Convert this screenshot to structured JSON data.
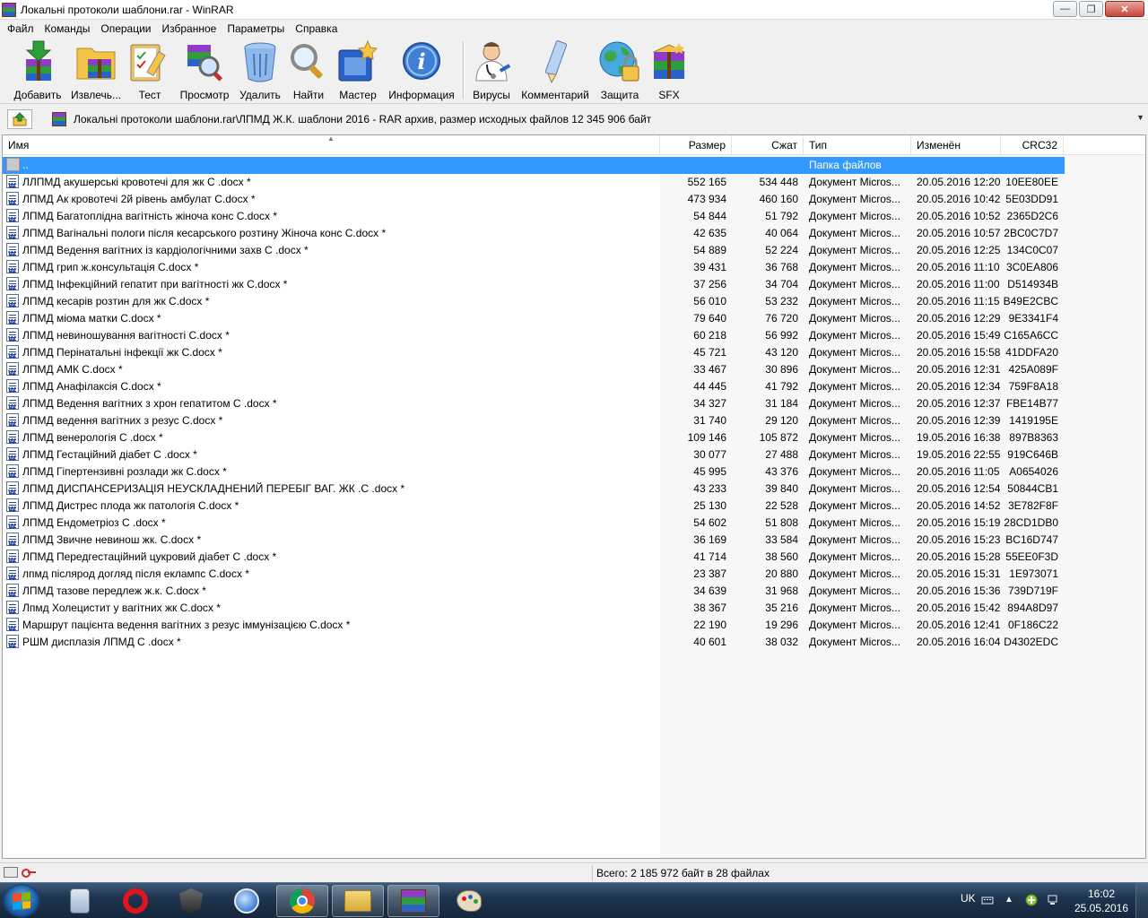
{
  "window": {
    "title": "Локальні протоколи шаблони.rar - WinRAR",
    "minimize_icon": "minimize-icon",
    "maximize_icon": "restore-icon",
    "close_icon": "close-icon"
  },
  "menu": [
    "Файл",
    "Команды",
    "Операции",
    "Избранное",
    "Параметры",
    "Справка"
  ],
  "toolbar": {
    "add": "Добавить",
    "extract": "Извлечь...",
    "test": "Тест",
    "view": "Просмотр",
    "delete": "Удалить",
    "find": "Найти",
    "wizard": "Мастер",
    "info": "Информация",
    "virus": "Вирусы",
    "comment": "Комментарий",
    "protect": "Защита",
    "sfx": "SFX"
  },
  "address": {
    "path": "Локальні протоколи шаблони.rar\\ЛПМД Ж.К. шаблони  2016 - RAR архив, размер исходных файлов 12 345 906 байт"
  },
  "columns": {
    "name": "Имя",
    "size": "Размер",
    "packed": "Сжат",
    "type": "Тип",
    "modified": "Изменён",
    "crc": "CRC32"
  },
  "parent_row": {
    "name": "..",
    "type": "Папка файлов"
  },
  "files": [
    {
      "name": "ЛЛПМД  акушерські кровотечі для жк С  .docx *",
      "size": "552 165",
      "packed": "534 448",
      "type": "Документ Micros...",
      "modified": "20.05.2016 12:20",
      "crc": "10EE80EE"
    },
    {
      "name": "ЛПМД  Ак кровотечі 2й рівень амбулат  C.docx *",
      "size": "473 934",
      "packed": "460 160",
      "type": "Документ Micros...",
      "modified": "20.05.2016 10:42",
      "crc": "5E03DD91"
    },
    {
      "name": "ЛПМД  Багатоплідна вагітність  жіноча конс  C.docx *",
      "size": "54 844",
      "packed": "51 792",
      "type": "Документ Micros...",
      "modified": "20.05.2016 10:52",
      "crc": "2365D2C6"
    },
    {
      "name": "ЛПМД  Вагінальні пологи після кесарського розтину  Жіноча конс  C.docx *",
      "size": "42 635",
      "packed": "40 064",
      "type": "Документ Micros...",
      "modified": "20.05.2016 10:57",
      "crc": "2BC0C7D7"
    },
    {
      "name": "ЛПМД  Ведення вагітних  із кардіологічними захв  С  .docx *",
      "size": "54 889",
      "packed": "52 224",
      "type": "Документ Micros...",
      "modified": "20.05.2016 12:25",
      "crc": "134C0C07"
    },
    {
      "name": "ЛПМД  грип ж.консультація C.docx *",
      "size": "39 431",
      "packed": "36 768",
      "type": "Документ Micros...",
      "modified": "20.05.2016 11:10",
      "crc": "3C0EA806"
    },
    {
      "name": "ЛПМД  Інфекційний гепатит при вагітності жк C.docx *",
      "size": "37 256",
      "packed": "34 704",
      "type": "Документ Micros...",
      "modified": "20.05.2016 11:00",
      "crc": "D514934B"
    },
    {
      "name": "ЛПМД  кесарів розтин для жк  C.docx *",
      "size": "56 010",
      "packed": "53 232",
      "type": "Документ Micros...",
      "modified": "20.05.2016 11:15",
      "crc": "B49E2CBC"
    },
    {
      "name": "ЛПМД  міома матки  C.docx *",
      "size": "79 640",
      "packed": "76 720",
      "type": "Документ Micros...",
      "modified": "20.05.2016 12:29",
      "crc": "9E3341F4"
    },
    {
      "name": "ЛПМД  невиношування вагітності  C.docx *",
      "size": "60 218",
      "packed": "56 992",
      "type": "Документ Micros...",
      "modified": "20.05.2016 15:49",
      "crc": "C165A6CC"
    },
    {
      "name": "ЛПМД  Перінатальні інфекції жк C.docx *",
      "size": "45 721",
      "packed": "43 120",
      "type": "Документ Micros...",
      "modified": "20.05.2016 15:58",
      "crc": "41DDFA20"
    },
    {
      "name": "ЛПМД АМК  C.docx *",
      "size": "33 467",
      "packed": "30 896",
      "type": "Документ Micros...",
      "modified": "20.05.2016 12:31",
      "crc": "425A089F"
    },
    {
      "name": "ЛПМД Анафілаксія  C.docx *",
      "size": "44 445",
      "packed": "41 792",
      "type": "Документ Micros...",
      "modified": "20.05.2016 12:34",
      "crc": "759F8A18"
    },
    {
      "name": "ЛПМД Ведення вагітних з  хрон гепатитом  С .docx *",
      "size": "34 327",
      "packed": "31 184",
      "type": "Документ Micros...",
      "modified": "20.05.2016 12:37",
      "crc": "FBE14B77"
    },
    {
      "name": "ЛПМД ведення вагітних з резус  C.docx *",
      "size": "31 740",
      "packed": "29 120",
      "type": "Документ Micros...",
      "modified": "20.05.2016 12:39",
      "crc": "1419195E"
    },
    {
      "name": "ЛПМД венерологія C .docx *",
      "size": "109 146",
      "packed": "105 872",
      "type": "Документ Micros...",
      "modified": "19.05.2016 16:38",
      "crc": "897B8363"
    },
    {
      "name": "ЛПМД Гестаційний діабет C .docx *",
      "size": "30 077",
      "packed": "27 488",
      "type": "Документ Micros...",
      "modified": "19.05.2016 22:55",
      "crc": "919C646B"
    },
    {
      "name": "ЛПМД Гіпертензивні розлади жк C.docx *",
      "size": "45 995",
      "packed": "43 376",
      "type": "Документ Micros...",
      "modified": "20.05.2016 11:05",
      "crc": "A0654026"
    },
    {
      "name": "ЛПМД ДИСПАНСЕРИЗАЦІЯ  НЕУСКЛАДНЕНИЙ ПЕРЕБІГ ВАГ. ЖК .C .docx *",
      "size": "43 233",
      "packed": "39 840",
      "type": "Документ Micros...",
      "modified": "20.05.2016 12:54",
      "crc": "50844CB1"
    },
    {
      "name": "ЛПМД Дистрес плода жк патологія C.docx *",
      "size": "25 130",
      "packed": "22 528",
      "type": "Документ Micros...",
      "modified": "20.05.2016 14:52",
      "crc": "3E782F8F"
    },
    {
      "name": "ЛПМД Ендометріоз С .docx *",
      "size": "54 602",
      "packed": "51 808",
      "type": "Документ Micros...",
      "modified": "20.05.2016 15:19",
      "crc": "28CD1DB0"
    },
    {
      "name": "ЛПМД Звичне невинош  жк. C.docx *",
      "size": "36 169",
      "packed": "33 584",
      "type": "Документ Micros...",
      "modified": "20.05.2016 15:23",
      "crc": "BC16D747"
    },
    {
      "name": "ЛПМД Передгестаційний цукровий діабет С .docx *",
      "size": "41 714",
      "packed": "38 560",
      "type": "Документ Micros...",
      "modified": "20.05.2016 15:28",
      "crc": "55EE0F3D"
    },
    {
      "name": "лпмд післярод догляд після еклампс C.docx *",
      "size": "23 387",
      "packed": "20 880",
      "type": "Документ Micros...",
      "modified": "20.05.2016 15:31",
      "crc": "1E973071"
    },
    {
      "name": "ЛПМД тазове передлеж ж.к. C.docx *",
      "size": "34 639",
      "packed": "31 968",
      "type": "Документ Micros...",
      "modified": "20.05.2016 15:36",
      "crc": "739D719F"
    },
    {
      "name": "Лпмд Холецистит у вагітних жк C.docx *",
      "size": "38 367",
      "packed": "35 216",
      "type": "Документ Micros...",
      "modified": "20.05.2016 15:42",
      "crc": "894A8D97"
    },
    {
      "name": "Маршрут пацієнта ведення вагітних з резус іммунізацією C.docx *",
      "size": "22 190",
      "packed": "19 296",
      "type": "Документ Micros...",
      "modified": "20.05.2016 12:41",
      "crc": "0F186C22"
    },
    {
      "name": "РШМ дисплазія ЛПМД С  .docx *",
      "size": "40 601",
      "packed": "38 032",
      "type": "Документ Micros...",
      "modified": "20.05.2016 16:04",
      "crc": "D4302EDC"
    }
  ],
  "status": {
    "total": "Всего: 2 185 972 байт в 28 файлах"
  },
  "taskbar": {
    "apps": [
      "calculator-icon",
      "opera-icon",
      "world-of-tanks-icon",
      "thunderbird-icon",
      "chrome-icon",
      "explorer-icon",
      "winrar-icon",
      "paint-icon"
    ],
    "lang": "UK",
    "time": "16:02",
    "date": "25.05.2016"
  }
}
